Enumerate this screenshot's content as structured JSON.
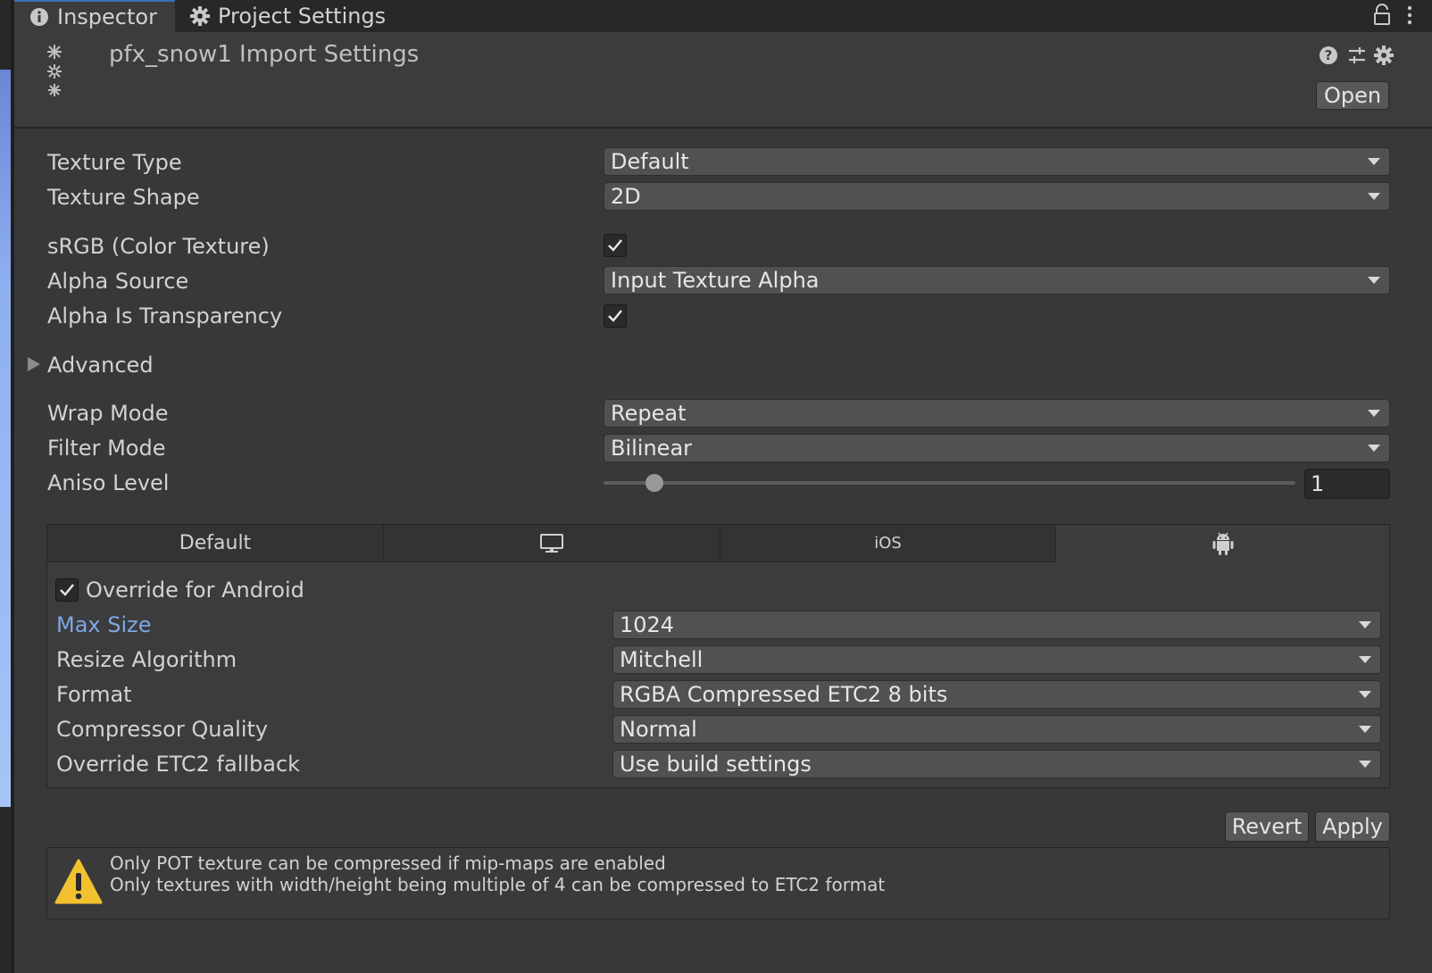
{
  "tabs": {
    "inspector": "Inspector",
    "project_settings": "Project Settings"
  },
  "header": {
    "asset_title": "pfx_snow1 Import Settings",
    "open_label": "Open"
  },
  "properties": {
    "texture_type": {
      "label": "Texture Type",
      "value": "Default"
    },
    "texture_shape": {
      "label": "Texture Shape",
      "value": "2D"
    },
    "srgb": {
      "label": "sRGB (Color Texture)",
      "checked": true
    },
    "alpha_source": {
      "label": "Alpha Source",
      "value": "Input Texture Alpha"
    },
    "alpha_is_transparency": {
      "label": "Alpha Is Transparency",
      "checked": true
    },
    "advanced": {
      "label": "Advanced",
      "expanded": false
    },
    "wrap_mode": {
      "label": "Wrap Mode",
      "value": "Repeat"
    },
    "filter_mode": {
      "label": "Filter Mode",
      "value": "Bilinear"
    },
    "aniso_level": {
      "label": "Aniso Level",
      "value": "1",
      "slider_fraction": 0.074
    }
  },
  "platform_tabs": {
    "default_label": "Default",
    "standalone_icon": "monitor-icon",
    "ios_label": "iOS",
    "android_icon": "android-icon",
    "active": "android"
  },
  "android": {
    "override": {
      "label": "Override for Android",
      "checked": true
    },
    "max_size": {
      "label": "Max Size",
      "value": "1024"
    },
    "resize_algorithm": {
      "label": "Resize Algorithm",
      "value": "Mitchell"
    },
    "format": {
      "label": "Format",
      "value": "RGBA Compressed ETC2 8 bits"
    },
    "compressor_quality": {
      "label": "Compressor Quality",
      "value": "Normal"
    },
    "etc2_fallback": {
      "label": "Override ETC2 fallback",
      "value": "Use build settings"
    }
  },
  "actions": {
    "revert_label": "Revert",
    "apply_label": "Apply"
  },
  "warning": {
    "line1": "Only POT texture can be compressed if mip-maps are enabled",
    "line2": "Only textures with width/height being multiple of 4 can be compressed to ETC2 format"
  },
  "colors": {
    "accent_blue": "#3a72b0",
    "overridden_label": "#7fa6e6",
    "warning_yellow": "#f2c12e"
  }
}
